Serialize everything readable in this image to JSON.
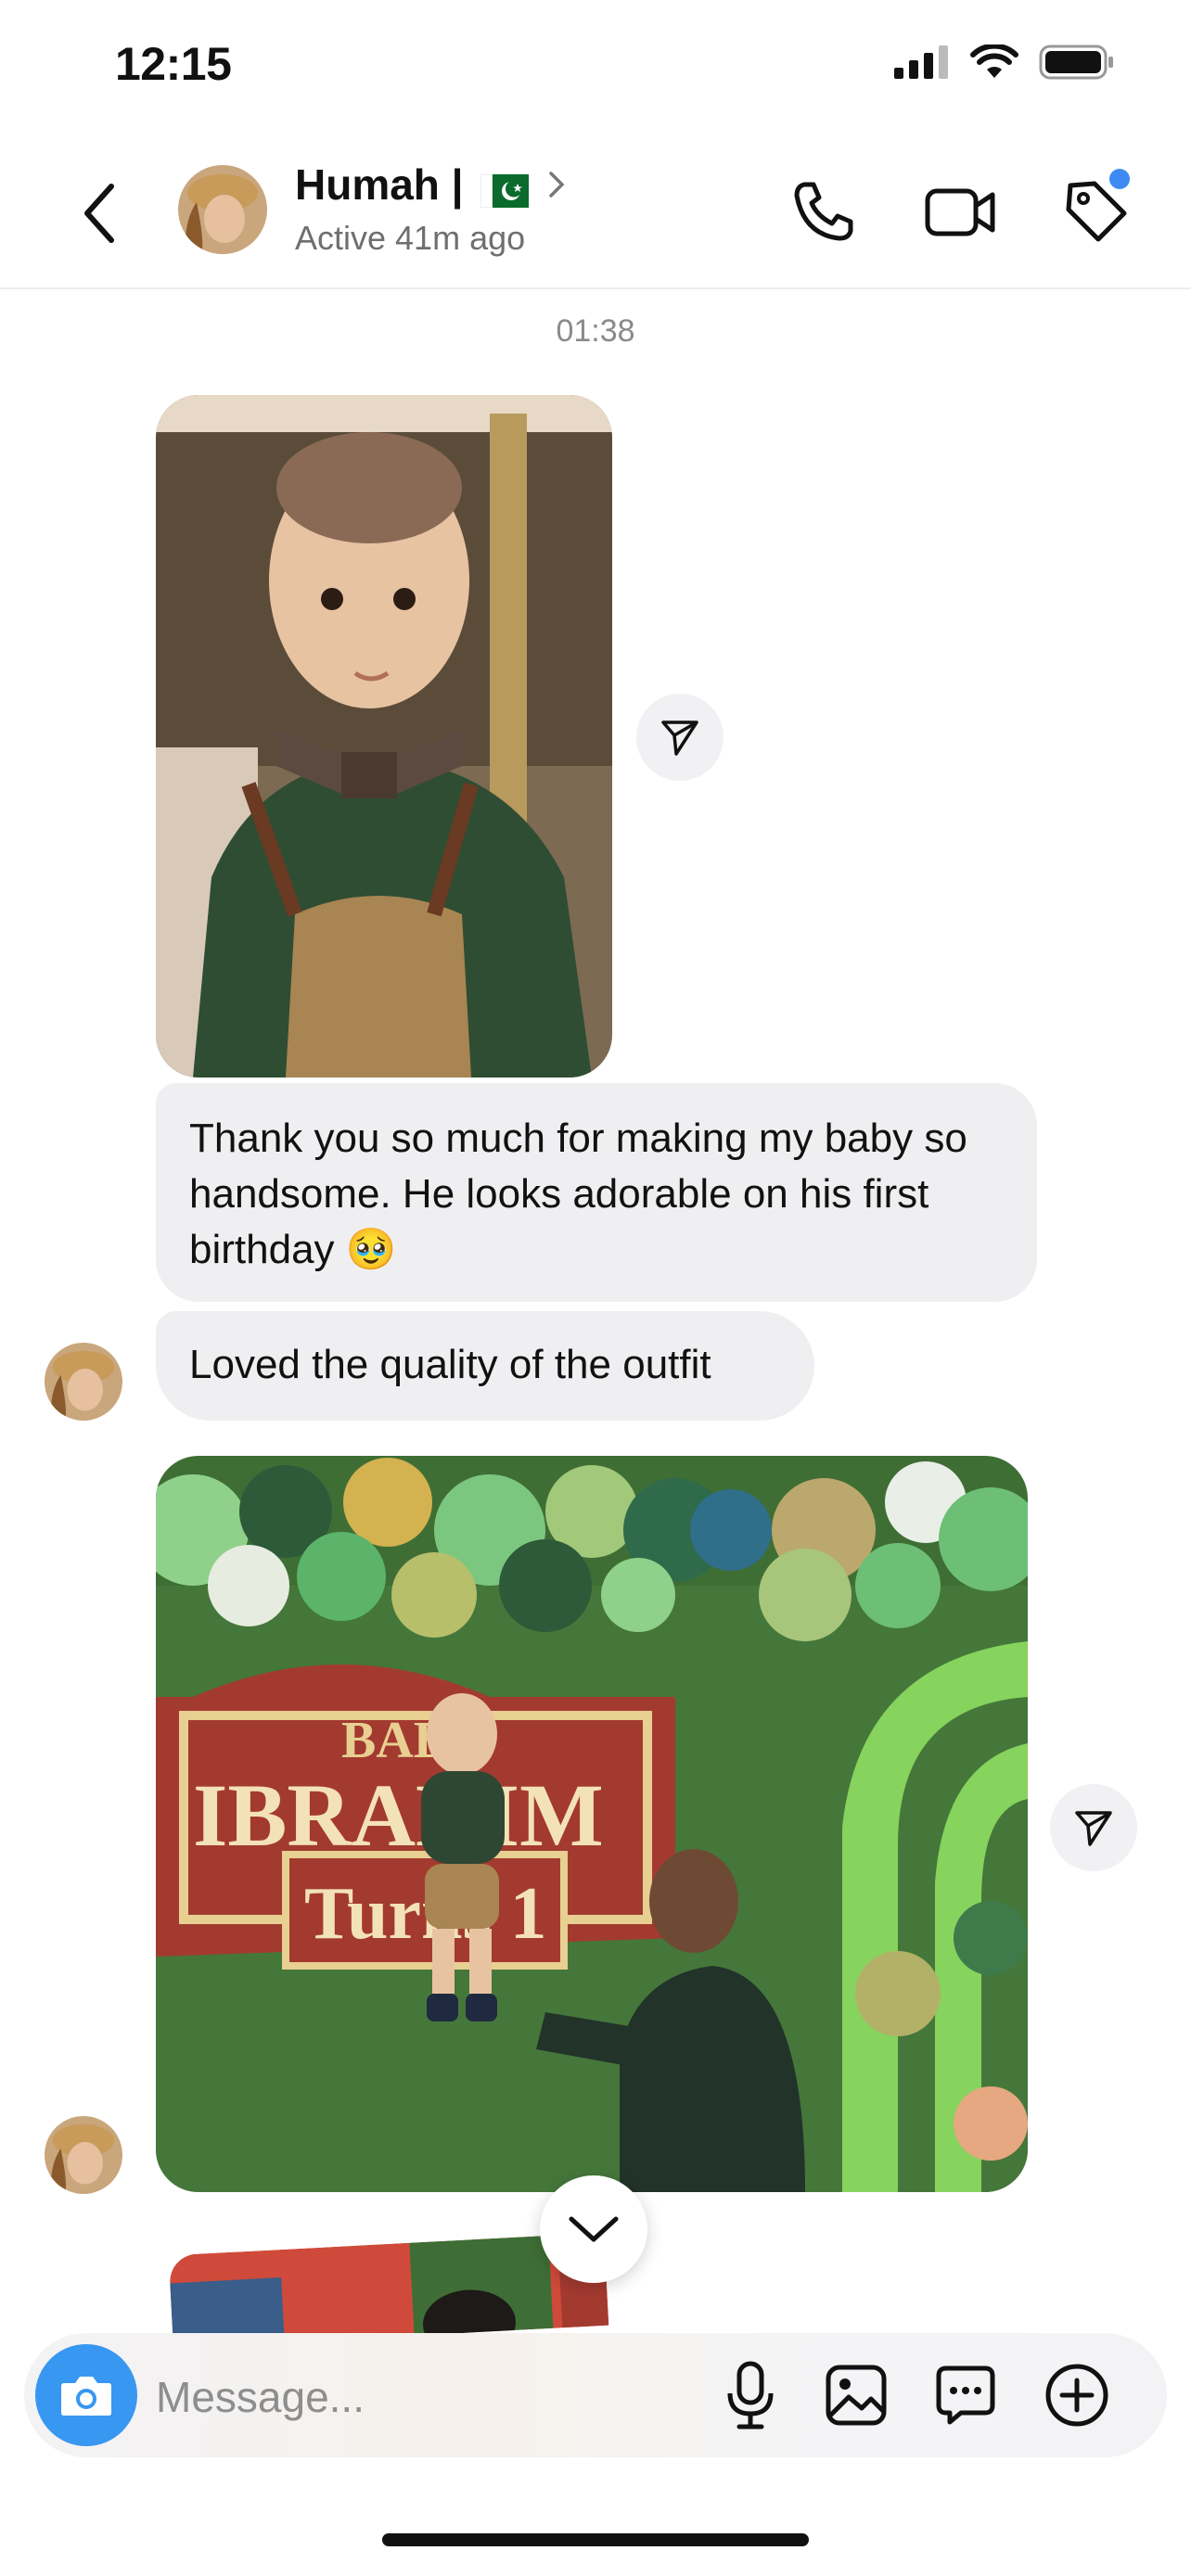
{
  "status_bar": {
    "time": "12:15"
  },
  "header": {
    "contact_name": "Humah |",
    "flag_emoji": "🇵🇰",
    "status": "Active 41m ago",
    "icons": [
      "back-chevron-icon",
      "phone-icon",
      "video-camera-icon",
      "tag-icon"
    ],
    "notification_dot_color": "#3d8bf2"
  },
  "thread": {
    "timestamp": "01:38",
    "messages": [
      {
        "type": "image",
        "description_icon": "photo-baby-portrait"
      },
      {
        "type": "text",
        "text": "Thank you so much for making my baby so handsome. He looks adorable on his first birthday 🥹"
      },
      {
        "type": "text",
        "text": "Loved the quality of the outfit"
      },
      {
        "type": "image",
        "description_icon": "photo-birthday-party"
      }
    ],
    "sign_line1": "BAB",
    "sign_line2": "IBRAHIM",
    "sign_line3": "Turns 1"
  },
  "composer": {
    "placeholder": "Message...",
    "accent": "#3897f0",
    "icons": [
      "camera-icon",
      "microphone-icon",
      "gallery-icon",
      "sticker-chat-icon",
      "plus-icon"
    ]
  }
}
